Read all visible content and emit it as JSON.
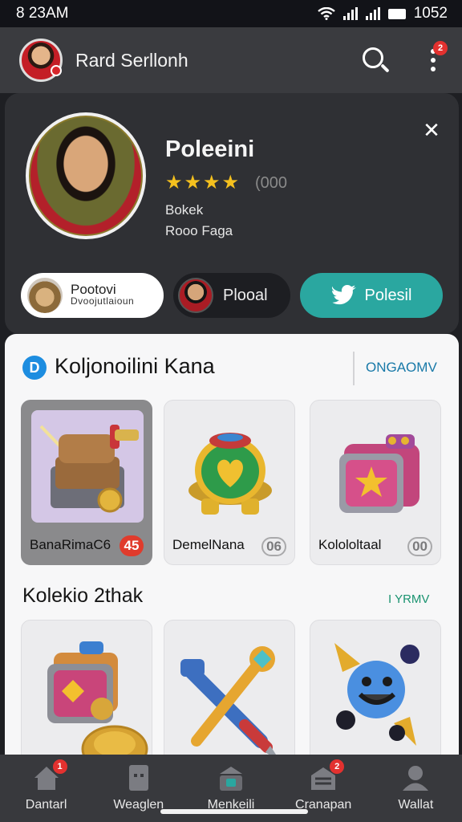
{
  "status_bar": {
    "time": "8 23AM",
    "clock": "1052"
  },
  "header": {
    "title": "Rard Serllonh",
    "notification_count": "2",
    "icons": {
      "search": "search-icon",
      "more": "more-vertical-icon"
    }
  },
  "profile": {
    "name": "Poleeini",
    "rating_value": "(000",
    "stars": 4,
    "line1": "Bokek",
    "line2": "Rooo Faga",
    "chips": [
      {
        "title": "Pootovi",
        "subtitle": "Dvoojutlaioun"
      },
      {
        "title": "Plooal"
      },
      {
        "title": "Polesil"
      }
    ]
  },
  "section1": {
    "title": "Koljonoilini Kana",
    "more": "ONGAOMV",
    "tiles": [
      {
        "label": "BanaRimaC6",
        "badge": "45"
      },
      {
        "label": "DemelNana",
        "badge": "06"
      },
      {
        "label": "Kolololtaal",
        "badge": "00"
      }
    ]
  },
  "section2": {
    "title": "Kolekio 2thak",
    "more": "I YRMV"
  },
  "nav": {
    "items": [
      {
        "label": "Dantarl",
        "badge": "1"
      },
      {
        "label": "Weaglen"
      },
      {
        "label": "Menkeili"
      },
      {
        "label": "Cranapan",
        "badge": "2"
      },
      {
        "label": "Wallat"
      }
    ]
  },
  "colors": {
    "accent_teal": "#2aa7a0",
    "badge_red": "#e03b2c",
    "star_gold": "#f4c01e",
    "panel_bg": "#f7f7f8"
  }
}
